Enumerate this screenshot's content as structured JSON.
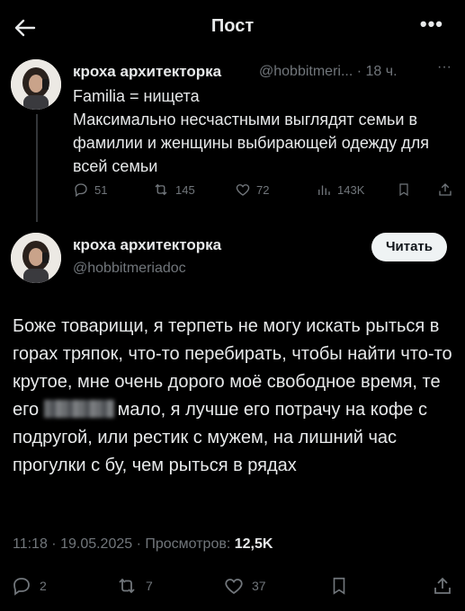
{
  "header": {
    "title": "Пост",
    "more_icon": "more-horizontal-icon",
    "back_icon": "arrow-left-icon"
  },
  "quoted_post": {
    "author_name": "кроха архитекторка",
    "handle": "@hobbitmeri...",
    "time": "· 18 ч.",
    "more": "···",
    "text": "Familia = нищета\nМаксимально несчастными выглядят семьи в фамилии и женщины выбирающей одежду для всей семьи",
    "stats": {
      "replies": "51",
      "reposts": "145",
      "likes": "72",
      "views": "143K"
    }
  },
  "main_post": {
    "author_name": "кроха архитекторка",
    "handle": "@hobbitmeriadoc",
    "follow_label": "Читать",
    "text_part1": "Боже товарищи, я терпеть не могу искать рыться в горах тряпок, что-то перебирать, чтобы найти что-то крутое, мне очень дорого моё свободное время, те его ",
    "text_part2": "мало, я лучше его потрачу на кофе с подругой, или рестик с мужем, на лишний час прогулки с бу, чем рыться в рядах",
    "time": "11:18 · 19.05.2025 · Просмотров:",
    "views": "12,5K",
    "stats": {
      "replies": "2",
      "reposts": "7",
      "likes": "37"
    }
  },
  "colors": {
    "background": "#000000",
    "text": "#e7e9ea",
    "secondary": "#71767b"
  }
}
